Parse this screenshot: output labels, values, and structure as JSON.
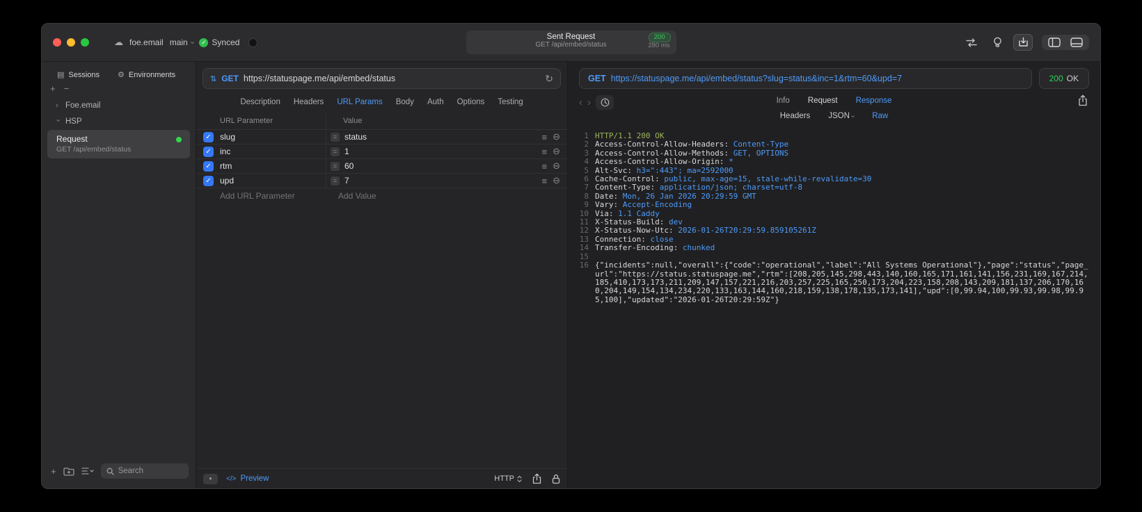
{
  "colors": {
    "accent_blue": "#4e9bfa",
    "success_green": "#30d158",
    "status_line_green": "#9cb45c",
    "checkbox_blue": "#3578f6"
  },
  "icons": {
    "cloud": "☁",
    "chevron": "›",
    "check": "✓",
    "sessions": "▤",
    "environments": "⚙",
    "plus": "+",
    "minus": "−",
    "method_switch": "⇅",
    "refresh": "↻",
    "equals": "=",
    "drag_handle": "≡",
    "remove_circle": "⊖",
    "console_triangle": "▲",
    "code_tag": "</>",
    "nav_back": "‹",
    "nav_forward": "›"
  },
  "titlebar": {
    "project": "foe.email",
    "branch": "main",
    "sync_status": "Synced",
    "capsule": {
      "title": "Sent Request",
      "status": "200",
      "subtitle": "GET /api/embed/status",
      "duration": "280 ms"
    }
  },
  "sidebar": {
    "tabs": [
      {
        "label": "Sessions"
      },
      {
        "label": "Environments"
      }
    ],
    "tree": [
      {
        "label": "Foe.email"
      },
      {
        "label": "HSP"
      }
    ],
    "request": {
      "title": "Request",
      "subtitle": "GET /api/embed/status"
    },
    "search_placeholder": "Search"
  },
  "request_pane": {
    "method": "GET",
    "url": "https://statuspage.me/api/embed/status",
    "tabs": [
      "Description",
      "Headers",
      "URL Params",
      "Body",
      "Auth",
      "Options",
      "Testing"
    ],
    "active_tab": "URL Params",
    "params": {
      "header_param": "URL Parameter",
      "header_value": "Value",
      "rows": [
        {
          "key": "slug",
          "value": "status"
        },
        {
          "key": "inc",
          "value": "1"
        },
        {
          "key": "rtm",
          "value": "60"
        },
        {
          "key": "upd",
          "value": "7"
        }
      ],
      "add_param": "Add URL Parameter",
      "add_value": "Add Value"
    },
    "footer": {
      "preview": "Preview",
      "protocol": "HTTP"
    }
  },
  "response_pane": {
    "method": "GET",
    "url": "https://statuspage.me/api/embed/status?slug=status&inc=1&rtm=60&upd=7",
    "status_code": "200",
    "status_text": "OK",
    "tabs": [
      "Info",
      "Request",
      "Response"
    ],
    "active_tab": "Response",
    "subtabs": [
      "Headers",
      "JSON",
      "Raw"
    ],
    "active_subtab": "Raw",
    "lines": [
      {
        "n": "1",
        "text": "HTTP/1.1 200 OK"
      },
      {
        "n": "2",
        "name": "Access-Control-Allow-Headers: ",
        "value": "Content-Type"
      },
      {
        "n": "3",
        "name": "Access-Control-Allow-Methods: ",
        "value": "GET, OPTIONS"
      },
      {
        "n": "4",
        "name": "Access-Control-Allow-Origin: ",
        "value": "*"
      },
      {
        "n": "5",
        "name": "Alt-Svc: ",
        "value": "h3=\":443\"; ma=2592000"
      },
      {
        "n": "6",
        "name": "Cache-Control: ",
        "value": "public, max-age=15, stale-while-revalidate=30"
      },
      {
        "n": "7",
        "name": "Content-Type: ",
        "value": "application/json; charset=utf-8"
      },
      {
        "n": "8",
        "name": "Date: ",
        "value": "Mon, 26 Jan 2026 20:29:59 GMT"
      },
      {
        "n": "9",
        "name": "Vary: ",
        "value": "Accept-Encoding"
      },
      {
        "n": "10",
        "name": "Via: ",
        "value": "1.1 Caddy"
      },
      {
        "n": "11",
        "name": "X-Status-Build: ",
        "value": "dev"
      },
      {
        "n": "12",
        "name": "X-Status-Now-Utc: ",
        "value": "2026-01-26T20:29:59.859105261Z"
      },
      {
        "n": "13",
        "name": "Connection: ",
        "value": "close"
      },
      {
        "n": "14",
        "name": "Transfer-Encoding: ",
        "value": "chunked"
      },
      {
        "n": "15"
      },
      {
        "n": "16",
        "text": "{\"incidents\":null,\"overall\":{\"code\":\"operational\",\"label\":\"All Systems Operational\"},\"page\":\"status\",\"page_url\":\"https://status.statuspage.me\",\"rtm\":[208,205,145,298,443,140,160,165,171,161,141,156,231,169,167,214,185,410,173,173,211,209,147,157,221,216,203,257,225,165,250,173,204,223,158,208,143,209,181,137,206,170,160,204,149,154,134,234,220,133,163,144,160,218,159,138,178,135,173,141],\"upd\":[0,99.94,100,99.93,99.98,99.95,100],\"updated\":\"2026-01-26T20:29:59Z\"}"
      }
    ]
  }
}
